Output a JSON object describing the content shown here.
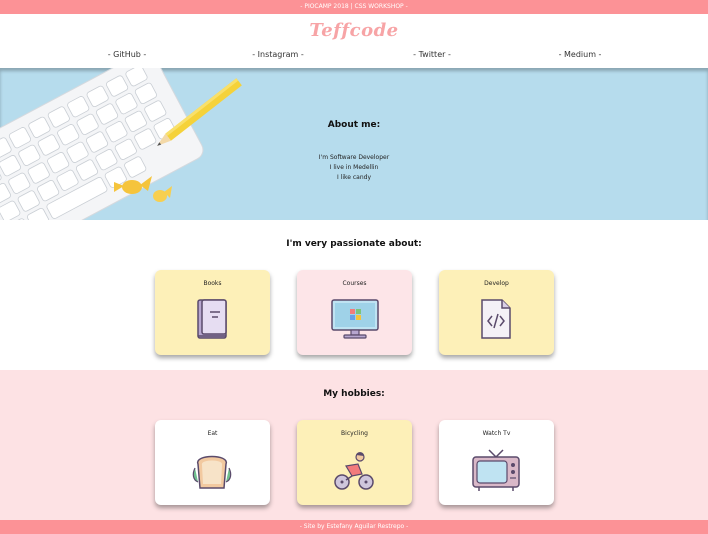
{
  "topbar": {
    "text": "- PIOCAMP 2018 | CSS WORKSHOP -"
  },
  "header": {
    "logo": "Teffcode",
    "nav": [
      {
        "label": "- GitHub -"
      },
      {
        "label": "- Instagram -"
      },
      {
        "label": "- Twitter -"
      },
      {
        "label": "- Medium -"
      }
    ]
  },
  "hero": {
    "title": "About me:",
    "lines": [
      "I'm Software Developer",
      "I live in Medellin",
      "I like candy"
    ]
  },
  "passion": {
    "title": "I'm very passionate about:",
    "cards": [
      {
        "label": "Books",
        "icon": "book-icon",
        "color": "#fdf0b8"
      },
      {
        "label": "Courses",
        "icon": "monitor-icon",
        "color": "#fde5e8"
      },
      {
        "label": "Develop",
        "icon": "code-file-icon",
        "color": "#fdf0b8"
      }
    ]
  },
  "hobbies": {
    "title": "My hobbies:",
    "cards": [
      {
        "label": "Eat",
        "icon": "sandwich-icon",
        "color": "#ffffff"
      },
      {
        "label": "Bicycling",
        "icon": "cyclist-icon",
        "color": "#fdf0b8"
      },
      {
        "label": "Watch Tv",
        "icon": "tv-icon",
        "color": "#ffffff"
      }
    ]
  },
  "colors": {
    "accent": "#fc9296",
    "hero_bg": "#b6dced",
    "hobbies_bg": "#fde2e4"
  },
  "footer": {
    "text": "- Site by Estefany Aguilar Restrepo -"
  }
}
